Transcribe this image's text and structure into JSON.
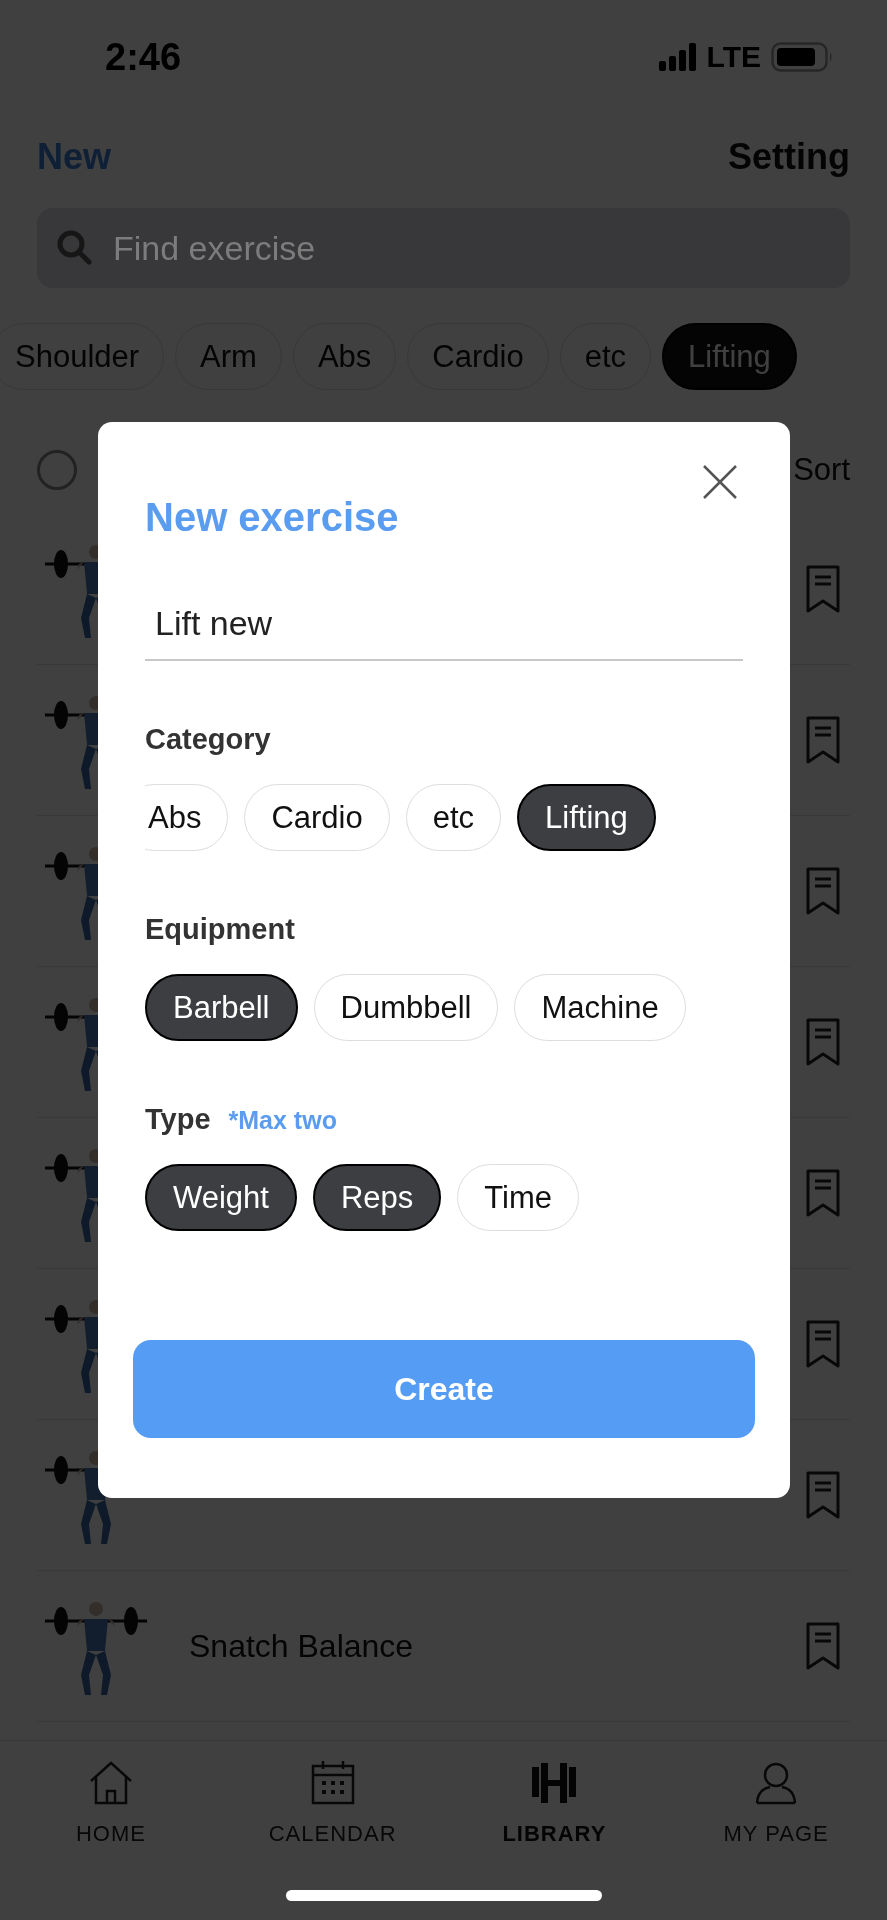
{
  "status_bar": {
    "time": "2:46",
    "network": "LTE"
  },
  "header": {
    "new_button": "New",
    "setting_button": "Setting"
  },
  "search": {
    "placeholder": "Find exercise"
  },
  "category_chips": [
    {
      "label": "Shoulder",
      "selected": false
    },
    {
      "label": "Arm",
      "selected": false
    },
    {
      "label": "Abs",
      "selected": false
    },
    {
      "label": "Cardio",
      "selected": false
    },
    {
      "label": "etc",
      "selected": false
    },
    {
      "label": "Lifting",
      "selected": true
    }
  ],
  "filter": {
    "checked": false,
    "sort_label": "Sort"
  },
  "exercises": [
    {
      "kind": "picture"
    },
    {
      "kind": "picture"
    },
    {
      "kind": "picture"
    },
    {
      "kind": "picture"
    },
    {
      "kind": "picture"
    },
    {
      "kind": "picture"
    },
    {
      "kind": "picture"
    },
    {
      "kind": "picture",
      "name": "Snatch Balance"
    }
  ],
  "modal": {
    "title": "New exercise",
    "name_value": "Lift new",
    "sections": [
      {
        "label": "Category",
        "chips": [
          {
            "label": "Abs",
            "selected": false
          },
          {
            "label": "Cardio",
            "selected": false
          },
          {
            "label": "etc",
            "selected": false
          },
          {
            "label": "Lifting",
            "selected": true
          }
        ]
      },
      {
        "label": "Equipment",
        "chips": [
          {
            "label": "Barbell",
            "selected": true
          },
          {
            "label": "Dumbbell",
            "selected": false
          },
          {
            "label": "Machine",
            "selected": false
          }
        ]
      },
      {
        "label": "Type",
        "note": "*Max two",
        "chips": [
          {
            "label": "Weight",
            "selected": true
          },
          {
            "label": "Reps",
            "selected": true
          },
          {
            "label": "Time",
            "selected": false
          }
        ]
      }
    ],
    "create_button": "Create"
  },
  "tab_bar": [
    {
      "label": "HOME",
      "selected": false
    },
    {
      "label": "CALENDAR",
      "selected": false
    },
    {
      "label": "LIBRARY",
      "selected": true
    },
    {
      "label": "MY PAGE",
      "selected": false
    }
  ]
}
